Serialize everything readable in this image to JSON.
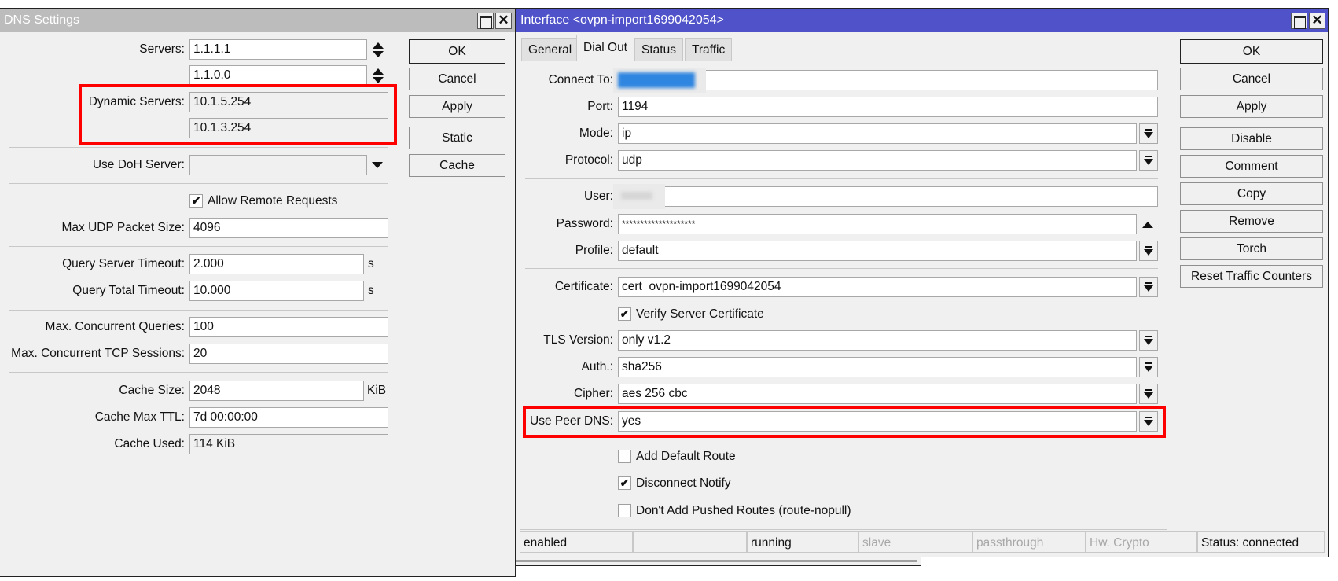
{
  "dns_window": {
    "title": "DNS Settings",
    "fields": {
      "servers_label": "Servers:",
      "servers": [
        "1.1.1.1",
        "1.1.0.0"
      ],
      "dynamic_servers_label": "Dynamic Servers:",
      "dynamic_servers": [
        "10.1.5.254",
        "10.1.3.254"
      ],
      "doh_label": "Use DoH Server:",
      "doh_value": "",
      "allow_remote_label": "Allow Remote Requests",
      "allow_remote_checked": true,
      "max_udp_label": "Max UDP Packet Size:",
      "max_udp_value": "4096",
      "qst_label": "Query Server Timeout:",
      "qst_value": "2.000",
      "qst_unit": "s",
      "qtt_label": "Query Total Timeout:",
      "qtt_value": "10.000",
      "qtt_unit": "s",
      "mcq_label": "Max. Concurrent Queries:",
      "mcq_value": "100",
      "mcts_label": "Max. Concurrent TCP Sessions:",
      "mcts_value": "20",
      "cache_size_label": "Cache Size:",
      "cache_size_value": "2048",
      "cache_size_unit": "KiB",
      "cache_ttl_label": "Cache Max TTL:",
      "cache_ttl_value": "7d 00:00:00",
      "cache_used_label": "Cache Used:",
      "cache_used_value": "114 KiB"
    },
    "buttons": {
      "ok": "OK",
      "cancel": "Cancel",
      "apply": "Apply",
      "static": "Static",
      "cache": "Cache"
    }
  },
  "interface_window": {
    "title": "Interface <ovpn-import1699042054>",
    "tabs": [
      {
        "label": "General",
        "active": false
      },
      {
        "label": "Dial Out",
        "active": true
      },
      {
        "label": "Status",
        "active": false
      },
      {
        "label": "Traffic",
        "active": false
      }
    ],
    "fields": {
      "connect_to_label": "Connect To:",
      "port_label": "Port:",
      "port_value": "1194",
      "mode_label": "Mode:",
      "mode_value": "ip",
      "protocol_label": "Protocol:",
      "protocol_value": "udp",
      "user_label": "User:",
      "password_label": "Password:",
      "password_value": "********************",
      "profile_label": "Profile:",
      "profile_value": "default",
      "certificate_label": "Certificate:",
      "certificate_value": "cert_ovpn-import1699042054",
      "verify_cert_label": "Verify Server Certificate",
      "verify_cert_checked": true,
      "tls_label": "TLS Version:",
      "tls_value": "only v1.2",
      "auth_label": "Auth.:",
      "auth_value": "sha256",
      "cipher_label": "Cipher:",
      "cipher_value": "aes 256 cbc",
      "use_peer_dns_label": "Use Peer DNS:",
      "use_peer_dns_value": "yes",
      "add_default_route_label": "Add Default Route",
      "add_default_route_checked": false,
      "disconnect_notify_label": "Disconnect Notify",
      "disconnect_notify_checked": true,
      "no_pushed_routes_label": "Don't Add Pushed Routes (route-nopull)",
      "no_pushed_routes_checked": false
    },
    "buttons": {
      "ok": "OK",
      "cancel": "Cancel",
      "apply": "Apply",
      "disable": "Disable",
      "comment": "Comment",
      "copy": "Copy",
      "remove": "Remove",
      "torch": "Torch",
      "reset_counters": "Reset Traffic Counters"
    },
    "status_bar": [
      "enabled",
      "",
      "running",
      "slave",
      "passthrough",
      "Hw. Crypto",
      "Status: connected"
    ]
  },
  "highlight_color": "#ff0000",
  "colors": {
    "inactive_title": "#bcbcbc",
    "active_title": "#4f52c8"
  }
}
